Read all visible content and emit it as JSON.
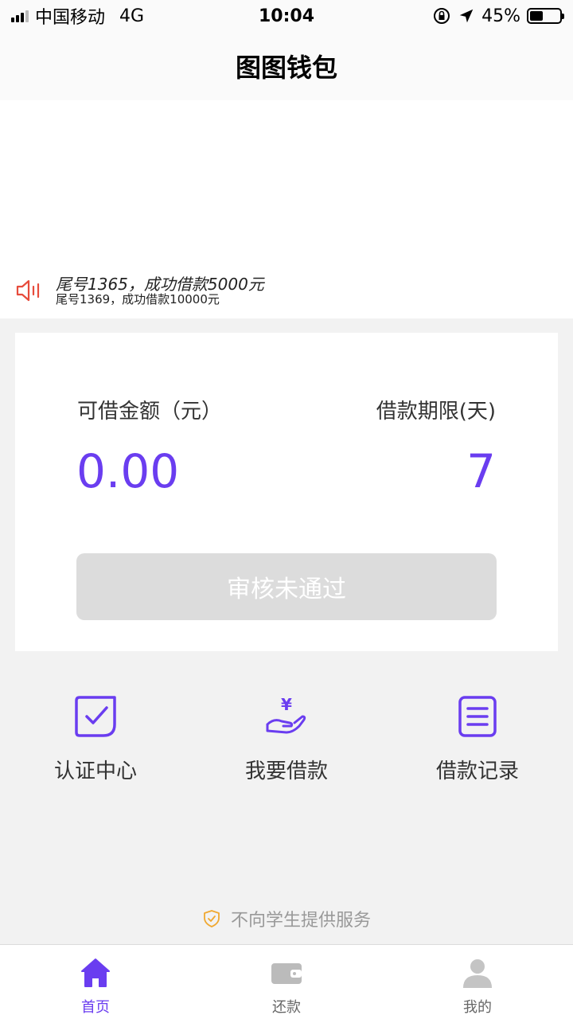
{
  "status_bar": {
    "carrier": "中国移动",
    "network": "4G",
    "time": "10:04",
    "battery": "45%"
  },
  "nav": {
    "title": "图图钱包"
  },
  "notice": {
    "line1": "尾号1365，成功借款5000元",
    "line2": "尾号1369，成功借款10000元"
  },
  "card": {
    "amount_label": "可借金额（元）",
    "term_label": "借款期限(天)",
    "amount": "0.00",
    "term": "7",
    "button_label": "审核未通过"
  },
  "actions": [
    {
      "label": "认证中心",
      "icon": "checkbox-icon"
    },
    {
      "label": "我要借款",
      "icon": "yen-hand-icon"
    },
    {
      "label": "借款记录",
      "icon": "list-document-icon"
    }
  ],
  "footer_note": "不向学生提供服务",
  "tabs": [
    {
      "label": "首页",
      "icon": "home-icon",
      "active": true
    },
    {
      "label": "还款",
      "icon": "wallet-icon",
      "active": false
    },
    {
      "label": "我的",
      "icon": "user-icon",
      "active": false
    }
  ],
  "colors": {
    "accent": "#6a3df0",
    "button_disabled": "#dcdcdc",
    "notice_icon": "#e74c3c",
    "shield": "#f0a830"
  }
}
